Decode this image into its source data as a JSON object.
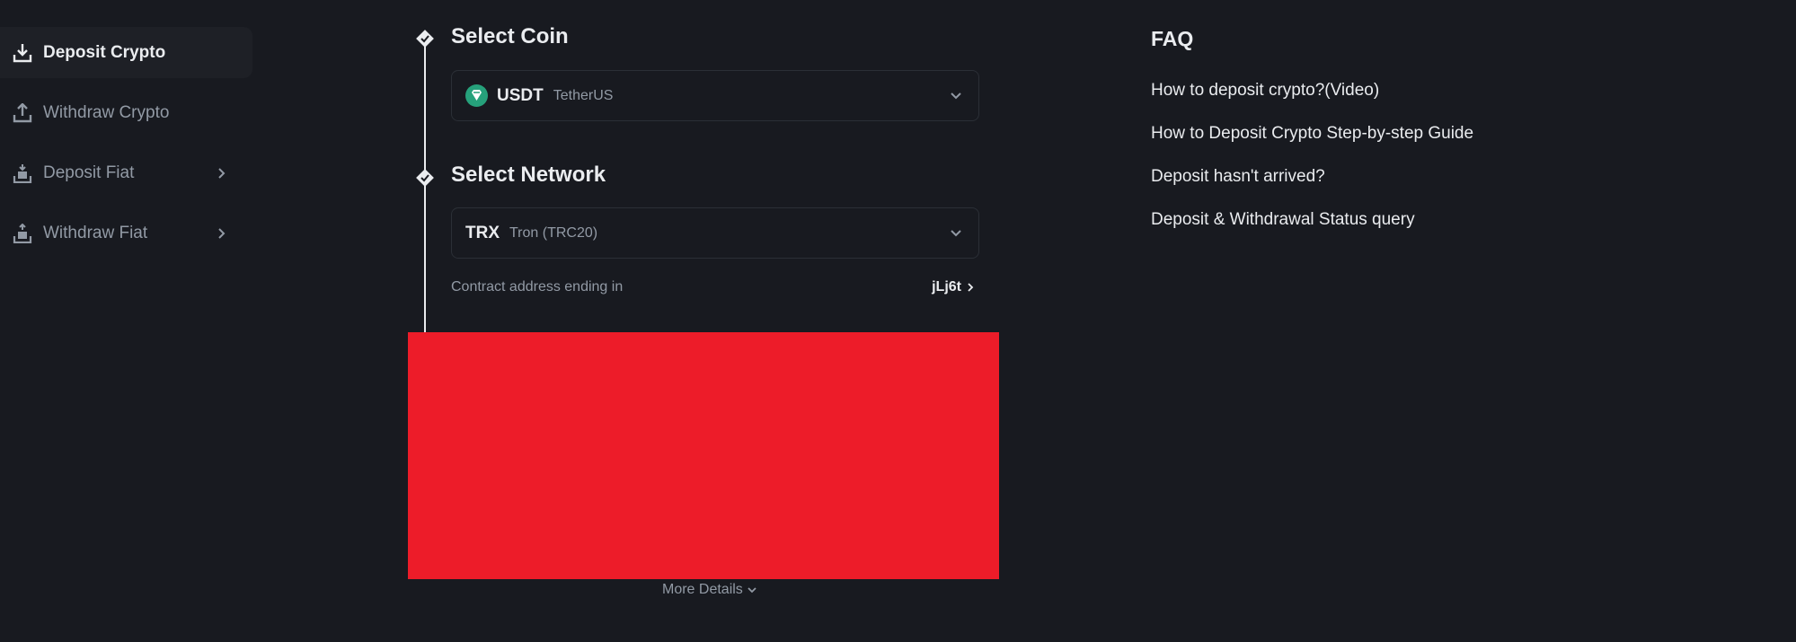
{
  "sidebar": {
    "items": [
      {
        "label": "Deposit Crypto",
        "icon": "download-icon",
        "active": true
      },
      {
        "label": "Withdraw Crypto",
        "icon": "upload-icon",
        "active": false
      },
      {
        "label": "Deposit Fiat",
        "icon": "deposit-fiat-icon",
        "active": false,
        "has_submenu": true
      },
      {
        "label": "Withdraw Fiat",
        "icon": "withdraw-fiat-icon",
        "active": false,
        "has_submenu": true
      }
    ]
  },
  "steps": {
    "coin": {
      "title": "Select Coin",
      "symbol": "USDT",
      "name": "TetherUS",
      "icon": "tether-icon",
      "icon_color": "#26a17b"
    },
    "network": {
      "title": "Select Network",
      "symbol": "TRX",
      "name": "Tron (TRC20)",
      "contract_label": "Contract address ending in",
      "contract_suffix": "jLj6t"
    }
  },
  "more_details": "More Details",
  "faq": {
    "title": "FAQ",
    "links": [
      "How to deposit crypto?(Video)",
      "How to Deposit Crypto Step-by-step Guide",
      "Deposit hasn't arrived?",
      "Deposit & Withdrawal Status query"
    ]
  },
  "colors": {
    "background": "#181a20",
    "text_primary": "#eaecef",
    "text_secondary": "#929aa5",
    "redaction": "#ed1c29"
  }
}
